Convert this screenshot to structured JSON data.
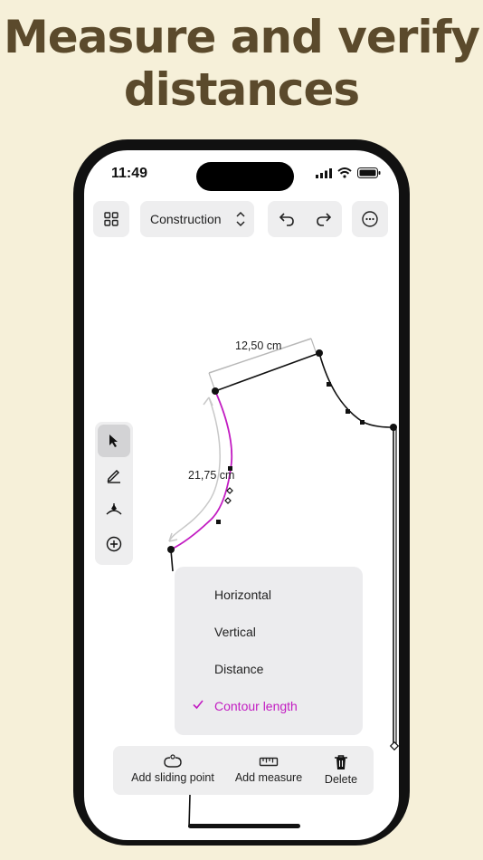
{
  "headline": {
    "line1": "Measure and verify",
    "line2": "distances"
  },
  "status_bar": {
    "time": "11:49"
  },
  "toolbar": {
    "mode_label": "Construction"
  },
  "canvas": {
    "measure_horizontal": "12,50 cm",
    "measure_curve": "21,75 cm"
  },
  "menu": {
    "items": [
      {
        "label": "Horizontal",
        "selected": false
      },
      {
        "label": "Vertical",
        "selected": false
      },
      {
        "label": "Distance",
        "selected": false
      },
      {
        "label": "Contour length",
        "selected": true
      }
    ]
  },
  "bottombar": {
    "add_sliding_point": "Add sliding point",
    "add_measure": "Add measure",
    "delete": "Delete"
  },
  "colors": {
    "accent": "#c21cc2",
    "background": "#f6f0d9",
    "headline": "#5b4a2c"
  }
}
